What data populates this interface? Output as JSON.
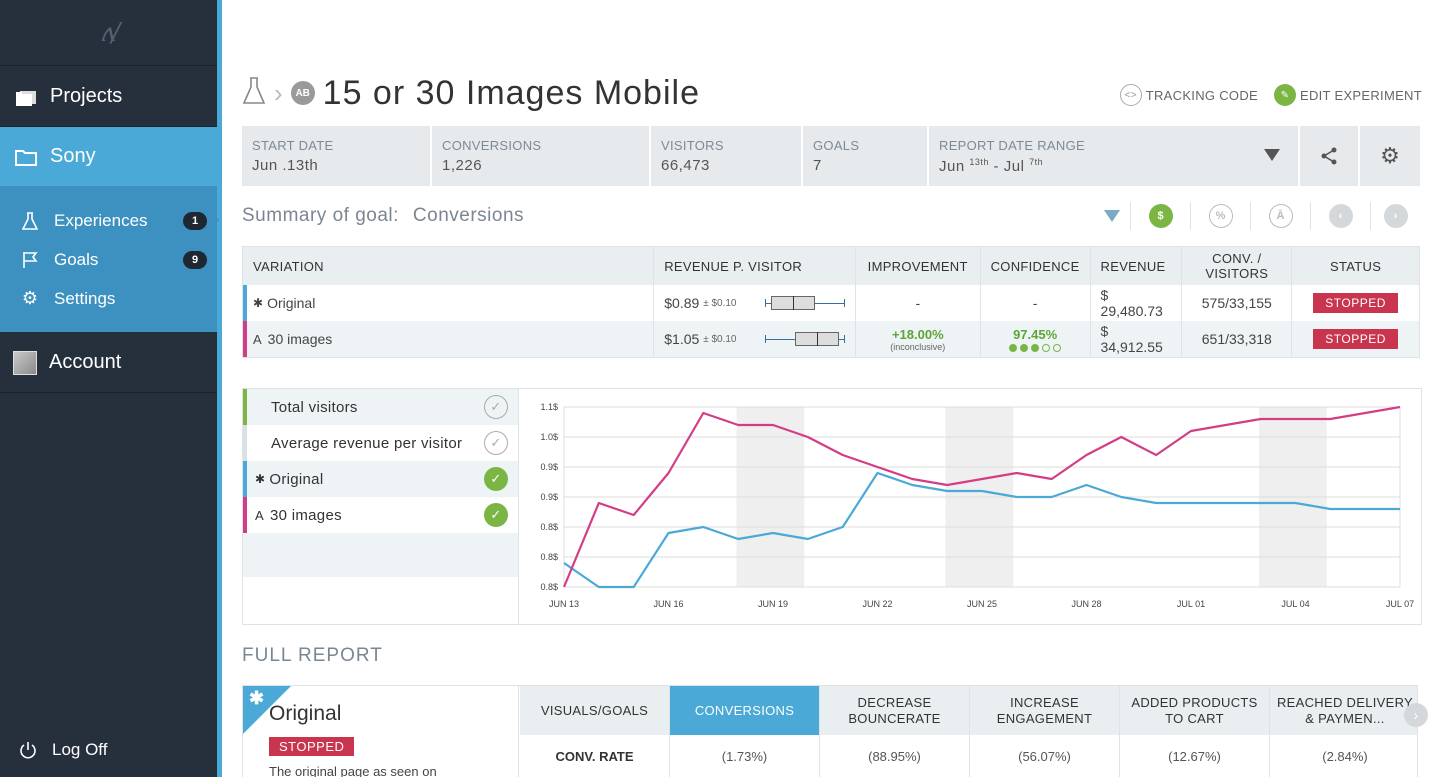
{
  "sidebar": {
    "logo": "ʌ/",
    "projects_label": "Projects",
    "project_name": "Sony",
    "items": [
      {
        "label": "Experiences",
        "badge": "1"
      },
      {
        "label": "Goals",
        "badge": "9"
      },
      {
        "label": "Settings",
        "badge": ""
      }
    ],
    "account_label": "Account",
    "logoff_label": "Log Off"
  },
  "header": {
    "badge": "AB",
    "title": "15 or 30 Images Mobile",
    "tracking_code": "TRACKING CODE",
    "edit_experiment": "EDIT EXPERIMENT"
  },
  "stats": [
    {
      "label": "START DATE",
      "value": "Jun .13th"
    },
    {
      "label": "CONVERSIONS",
      "value": "1,226"
    },
    {
      "label": "VISITORS",
      "value": "66,473"
    },
    {
      "label": "GOALS",
      "value": "7"
    }
  ],
  "date_range": {
    "label": "REPORT DATE RANGE",
    "from": "Jun ",
    "from_sup": "13th",
    "sep": " - Jul ",
    "to_sup": "7th"
  },
  "summary": {
    "label": "Summary of goal:",
    "goal": "Conversions",
    "tools": [
      "$",
      "%",
      "Ā"
    ]
  },
  "table": {
    "headers": [
      "VARIATION",
      "REVENUE P. VISITOR",
      "IMPROVEMENT",
      "CONFIDENCE",
      "REVENUE",
      "CONV. / VISITORS",
      "STATUS"
    ],
    "rows": [
      {
        "marker": "✱",
        "name": "Original",
        "rpv": "$0.89",
        "rpv_err": "± $0.10",
        "improvement": "-",
        "improvement_note": "",
        "confidence": "-",
        "confidence_level": 0,
        "revenue": "$ 29,480.73",
        "conv_visitors": "575/33,155",
        "status": "STOPPED"
      },
      {
        "marker": "A",
        "name": "30 images",
        "rpv": "$1.05",
        "rpv_err": "± $0.10",
        "improvement": "+18.00%",
        "improvement_note": "(inconclusive)",
        "confidence": "97.45%",
        "confidence_level": 3,
        "revenue": "$ 34,912.55",
        "conv_visitors": "651/33,318",
        "status": "STOPPED"
      }
    ]
  },
  "legend": [
    {
      "label": "Total visitors",
      "checked": false,
      "color": "#7bb544"
    },
    {
      "label": "Average revenue per visitor",
      "checked": false,
      "color": "#d8e1e6"
    },
    {
      "marker": "✱",
      "label": "Original",
      "checked": true,
      "color": "#4aa9d6"
    },
    {
      "marker": "A",
      "label": "30 images",
      "checked": true,
      "color": "#d43d86"
    }
  ],
  "chart_data": {
    "type": "line",
    "x_labels": [
      "JUN 13",
      "JUN 16",
      "JUN 19",
      "JUN 22",
      "JUN 25",
      "JUN 28",
      "JUL 01",
      "JUL 04",
      "JUL 07"
    ],
    "y_ticks": [
      "1.1$",
      "1.0$",
      "0.9$",
      "0.9$",
      "0.8$",
      "0.8$",
      "0.8$"
    ],
    "ylim": [
      0.8,
      1.1
    ],
    "grid": true,
    "series": [
      {
        "name": "Original",
        "color": "#4aa9d6",
        "values": [
          0.84,
          0.8,
          0.8,
          0.89,
          0.9,
          0.88,
          0.89,
          0.88,
          0.9,
          0.99,
          0.97,
          0.96,
          0.96,
          0.95,
          0.95,
          0.97,
          0.95,
          0.94,
          0.94,
          0.94,
          0.94,
          0.94,
          0.93,
          0.93,
          0.93
        ]
      },
      {
        "name": "30 images",
        "color": "#d43d86",
        "values": [
          0.8,
          0.94,
          0.92,
          0.99,
          1.09,
          1.07,
          1.07,
          1.05,
          1.02,
          1.0,
          0.98,
          0.97,
          0.98,
          0.99,
          0.98,
          1.02,
          1.05,
          1.02,
          1.06,
          1.07,
          1.08,
          1.08,
          1.08,
          1.09,
          1.1
        ]
      }
    ]
  },
  "full_report": {
    "title": "FULL REPORT",
    "variation": {
      "marker": "✱",
      "name": "Original",
      "status": "STOPPED",
      "description": "The original page as seen on"
    },
    "row_label": "CONV. RATE",
    "columns": [
      {
        "label": "VISUALS/GOALS",
        "value": "CONV. RATE"
      },
      {
        "label": "CONVERSIONS",
        "value": "(1.73%)",
        "active": true
      },
      {
        "label": "DECREASE BOUNCERATE",
        "value": "(88.95%)"
      },
      {
        "label": "INCREASE ENGAGEMENT",
        "value": "(56.07%)"
      },
      {
        "label": "ADDED PRODUCTS TO CART",
        "value": "(12.67%)"
      },
      {
        "label": "REACHED DELIVERY & PAYMEN...",
        "value": "(2.84%)"
      }
    ]
  },
  "colors": {
    "accent": "#4aa9d6",
    "sidebar": "#262f3c",
    "stopped": "#c9344e",
    "success": "#7bb544",
    "variation_a": "#d43d86"
  }
}
